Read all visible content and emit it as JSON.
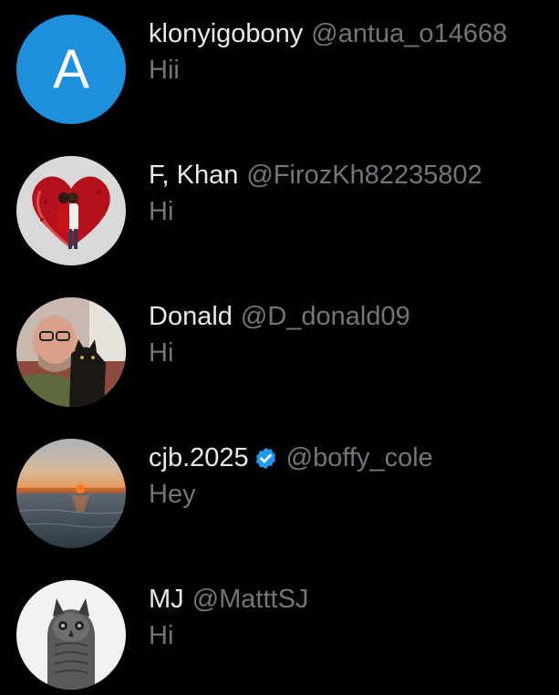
{
  "conversations": [
    {
      "name": "klonyigobony",
      "handle": "@antua_o14668",
      "message": "Hii",
      "avatar_letter": "A",
      "avatar_color": "#1d8fdc",
      "avatar": "letter-avatar"
    },
    {
      "name": "F, Khan",
      "handle": "@FirozKh82235802",
      "message": "Hi",
      "avatar": "heart-couple-avatar"
    },
    {
      "name": "Donald",
      "handle": "@D_donald09",
      "message": "Hi",
      "avatar": "man-with-cat-avatar"
    },
    {
      "name": "cjb.2025",
      "handle": "@boffy_cole",
      "message": "Hey",
      "verified": true,
      "avatar": "sunset-sea-avatar"
    },
    {
      "name": "MJ",
      "handle": "@MatttSJ",
      "message": "Hi",
      "avatar": "owl-avatar"
    }
  ],
  "colors": {
    "background": "#000000",
    "name_text": "#e7e9ea",
    "secondary_text": "#71767b",
    "verified_badge": "#1d9bf0"
  }
}
